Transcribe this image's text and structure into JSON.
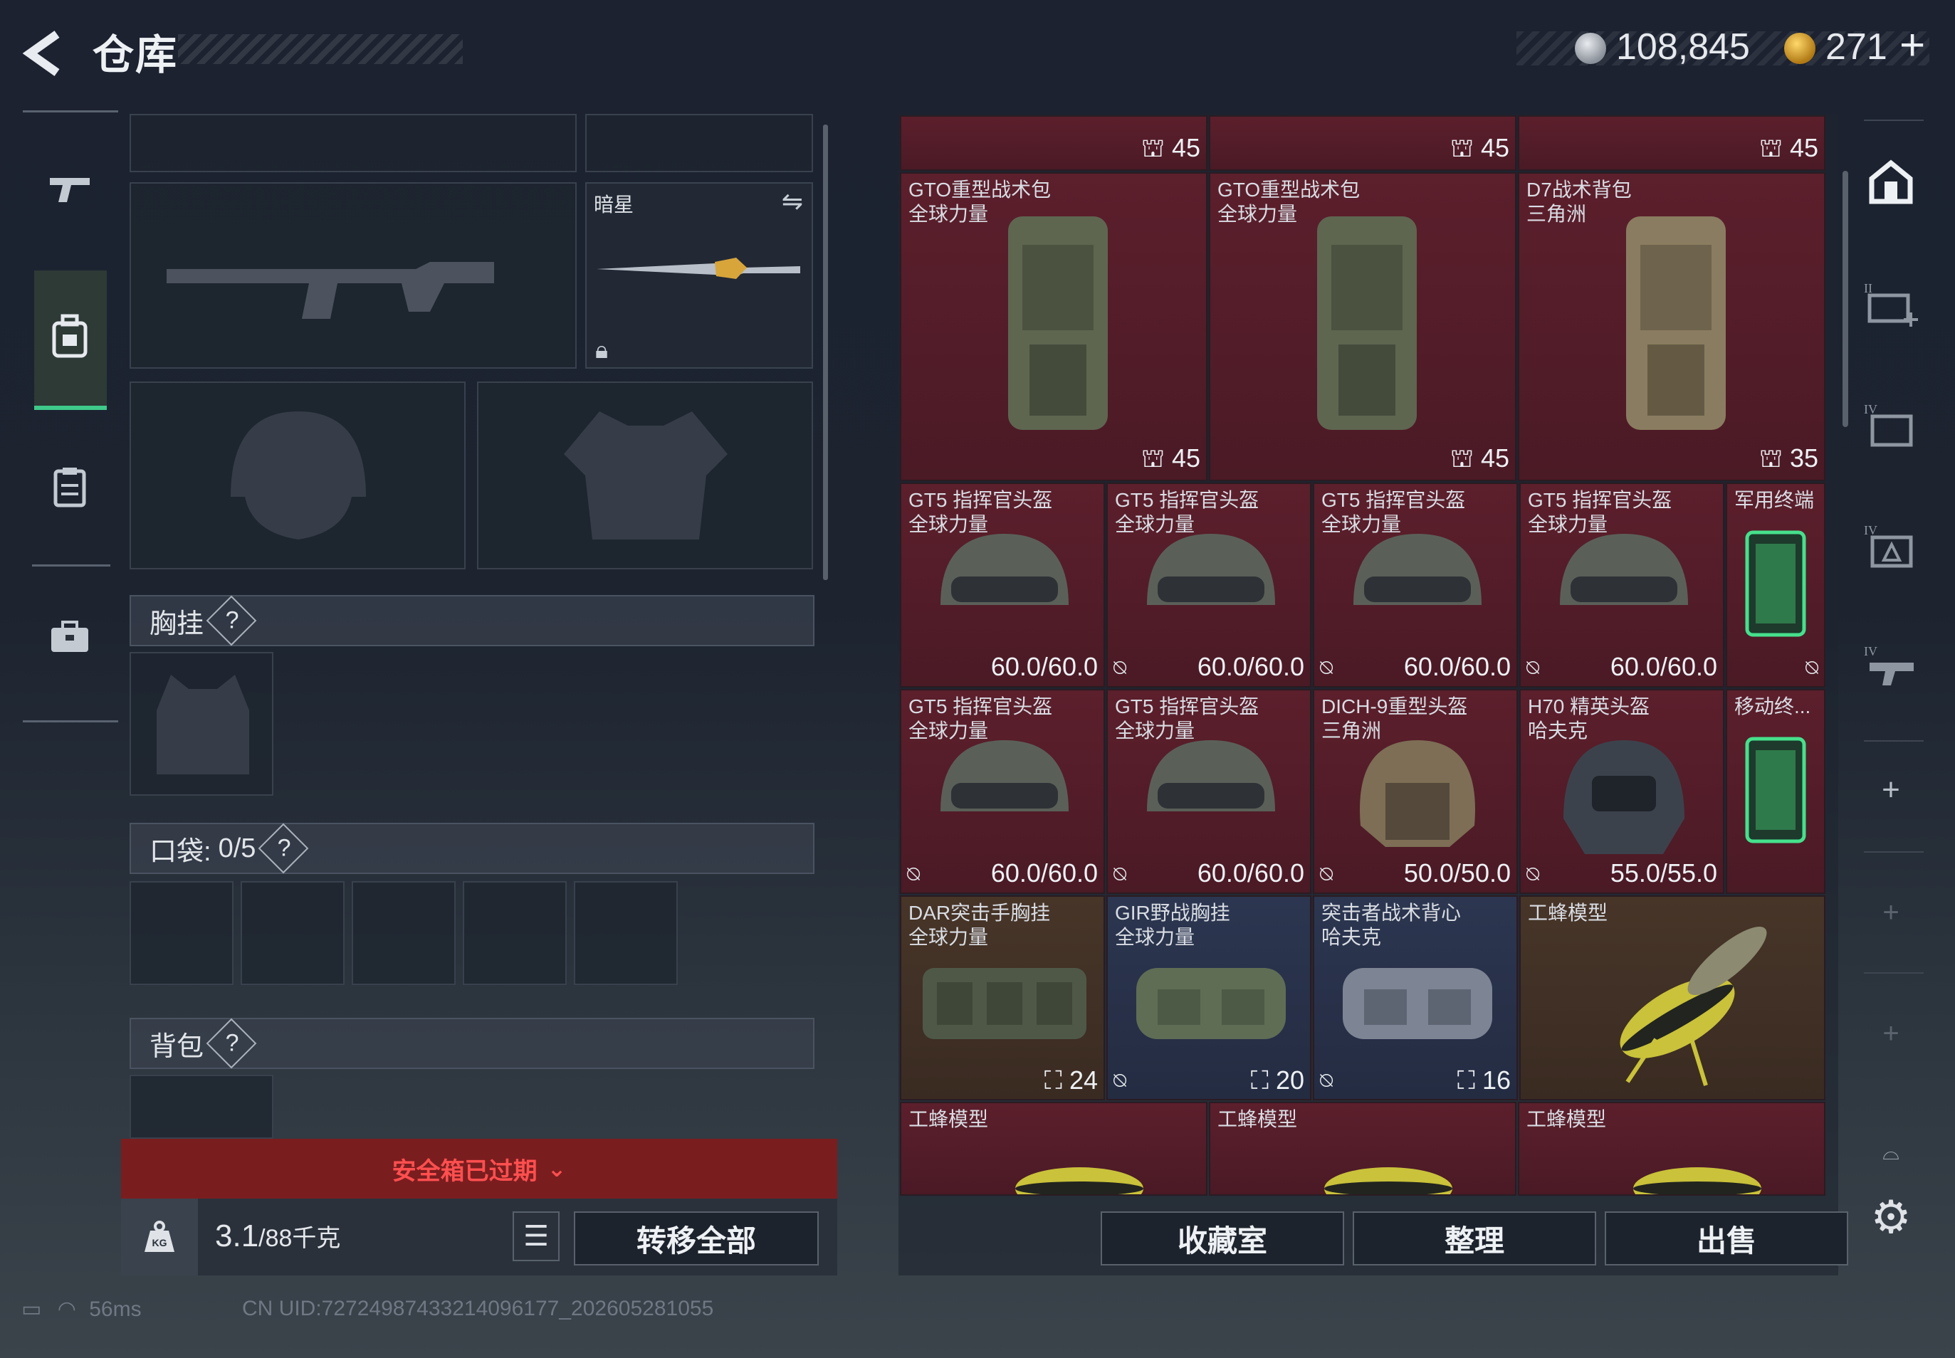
{
  "header": {
    "back_icon": "back-arrow-icon",
    "title": "仓库",
    "currency1_icon": "silver-coin-icon",
    "currency1": "108,845",
    "currency2_icon": "gold-coin-icon",
    "currency2": "271",
    "add_label": "+"
  },
  "rail": {
    "items": [
      "gun-icon",
      "backpack-icon",
      "clipboard-icon",
      "briefcase-icon"
    ]
  },
  "loadout": {
    "melee_label": "暗星",
    "chest_label": "胸挂",
    "pocket_label": "口袋:",
    "pocket_count": "0/5",
    "backpack_label": "背包",
    "help": "?"
  },
  "footer_left": {
    "warning": "安全箱已过期",
    "weight_value": "3.1",
    "weight_unit": "/88千克",
    "weight_badge": "KG",
    "transfer_label": "转移全部"
  },
  "grid": {
    "top_badges": [
      "45",
      "45",
      "45"
    ],
    "backpacks": [
      {
        "name": "GTO重型战术包",
        "sub": "全球力量",
        "cap": "45"
      },
      {
        "name": "GTO重型战术包",
        "sub": "全球力量",
        "cap": "45"
      },
      {
        "name": "D7战术背包",
        "sub": "三角洲",
        "cap": "35"
      }
    ],
    "row_helmets_1": [
      {
        "name": "GT5 指挥官头盔",
        "sub": "全球力量",
        "dur": "60.0/60.0"
      },
      {
        "name": "GT5 指挥官头盔",
        "sub": "全球力量",
        "dur": "60.0/60.0"
      },
      {
        "name": "GT5 指挥官头盔",
        "sub": "全球力量",
        "dur": "60.0/60.0"
      },
      {
        "name": "GT5 指挥官头盔",
        "sub": "全球力量",
        "dur": "60.0/60.0"
      },
      {
        "name": "军用终端",
        "sub": "",
        "dur": ""
      }
    ],
    "row_helmets_2": [
      {
        "name": "GT5 指挥官头盔",
        "sub": "全球力量",
        "dur": "60.0/60.0"
      },
      {
        "name": "GT5 指挥官头盔",
        "sub": "全球力量",
        "dur": "60.0/60.0"
      },
      {
        "name": "DICH-9重型头盔",
        "sub": "三角洲",
        "dur": "50.0/50.0"
      },
      {
        "name": "H70 精英头盔",
        "sub": "哈夫克",
        "dur": "55.0/55.0"
      },
      {
        "name": "移动终...",
        "sub": "",
        "dur": ""
      }
    ],
    "row_chest": [
      {
        "name": "DAR突击手胸挂",
        "sub": "全球力量",
        "cap": "24"
      },
      {
        "name": "GIR野战胸挂",
        "sub": "全球力量",
        "cap": "20"
      },
      {
        "name": "突击者战术背心",
        "sub": "哈夫克",
        "cap": "16"
      },
      {
        "name": "工蜂模型",
        "sub": "",
        "cap": ""
      }
    ],
    "row_bottom": [
      {
        "name": "工蜂模型"
      },
      {
        "name": "工蜂模型"
      },
      {
        "name": "工蜂模型"
      }
    ]
  },
  "tabs": {
    "collection": "收藏室",
    "sort": "整理",
    "sell": "出售"
  },
  "right_rail": {
    "items": [
      "home-icon",
      "add-case-icon",
      "case-iv-icon",
      "case-iv-alt-icon",
      "case-iv-gun-icon",
      "plus-icon",
      "plus-icon",
      "plus-icon",
      "bag-small-icon",
      "settings-icon"
    ],
    "tier_labels": [
      "II",
      "IV",
      "IV",
      "IV"
    ]
  },
  "statusbar": {
    "ping": "56ms",
    "uid": "CN UID:72724987433214096177_202605281055"
  },
  "colors": {
    "red_rarity": "#5c1f2c",
    "blue_rarity": "#2c3650",
    "gold_rarity": "#473528",
    "accent_green": "#3fc98a",
    "warning_red": "#ff4f4f"
  }
}
